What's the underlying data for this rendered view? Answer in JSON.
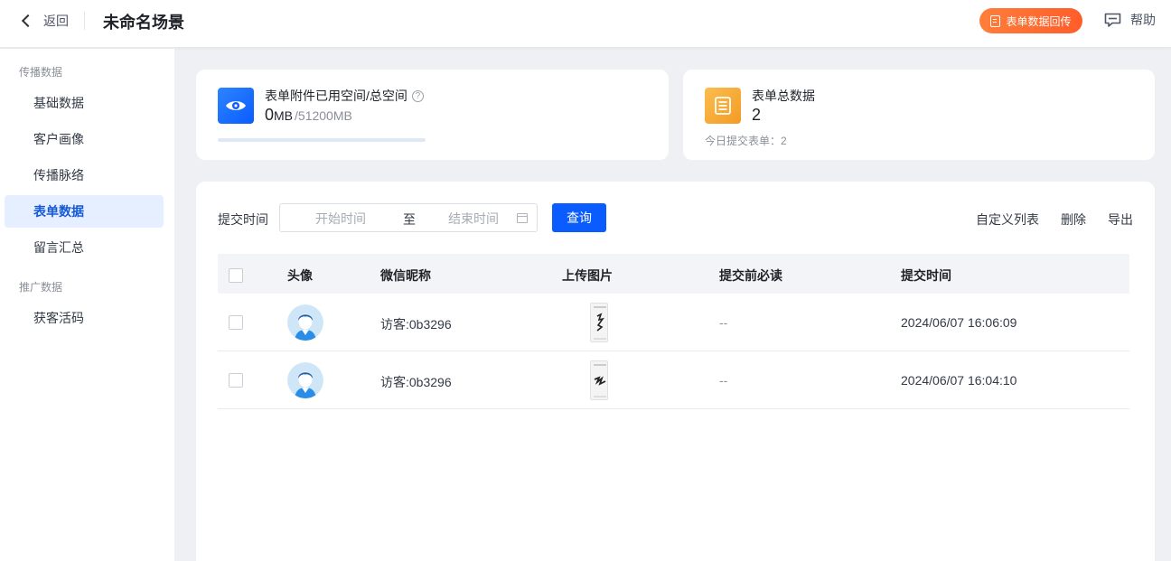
{
  "header": {
    "back_label": "返回",
    "title": "未命名场景",
    "upload_back_label": "表单数据回传",
    "help_label": "帮助"
  },
  "sidebar": {
    "groups": [
      {
        "label": "传播数据"
      },
      {
        "label": "推广数据"
      }
    ],
    "items": [
      {
        "label": "基础数据",
        "active": false
      },
      {
        "label": "客户画像",
        "active": false
      },
      {
        "label": "传播脉络",
        "active": false
      },
      {
        "label": "表单数据",
        "active": true
      },
      {
        "label": "留言汇总",
        "active": false
      },
      {
        "label": "获客活码",
        "active": false
      }
    ]
  },
  "storage": {
    "label": "表单附件已用空间/总空间",
    "help_icon": "?",
    "used_value": "0",
    "used_unit": "MB",
    "total": "/51200MB",
    "usage_fraction": 0
  },
  "form_total": {
    "label": "表单总数据",
    "value": "2",
    "today_note": "今日提交表单：2"
  },
  "filter": {
    "label": "提交时间",
    "start_placeholder": "开始时间",
    "separator": "至",
    "end_placeholder": "结束时间",
    "query_label": "查询"
  },
  "toolbar": {
    "custom_columns": "自定义列表",
    "delete": "删除",
    "export": "导出"
  },
  "table": {
    "columns": [
      "头像",
      "微信昵称",
      "上传图片",
      "提交前必读",
      "提交时间"
    ],
    "rows": [
      {
        "nickname": "访客:0b3296",
        "must_read": "--",
        "submit_time": "2024/06/07 16:06:09"
      },
      {
        "nickname": "访客:0b3296",
        "must_read": "--",
        "submit_time": "2024/06/07 16:04:10"
      }
    ]
  },
  "colors": {
    "primary": "#0a5cff",
    "active_menu_bg": "#e6efff",
    "orange_button": "#ff6b32",
    "blue_stat_icon": "#1e6fff",
    "orange_stat_icon": "#f7a233"
  }
}
